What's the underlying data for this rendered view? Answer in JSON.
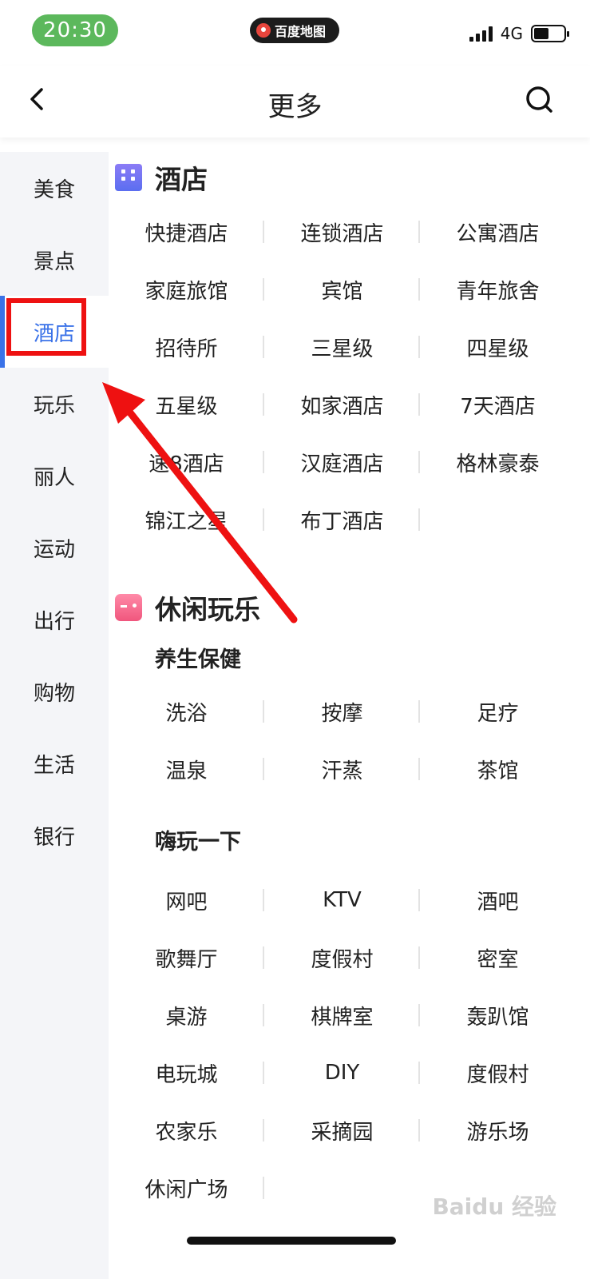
{
  "status_bar": {
    "time": "20:30",
    "app_badge": "百度地图",
    "network": "4G"
  },
  "header": {
    "title": "更多"
  },
  "sidebar": {
    "items": [
      {
        "label": "美食"
      },
      {
        "label": "景点"
      },
      {
        "label": "酒店",
        "active": true
      },
      {
        "label": "玩乐"
      },
      {
        "label": "丽人"
      },
      {
        "label": "运动"
      },
      {
        "label": "出行"
      },
      {
        "label": "购物"
      },
      {
        "label": "生活"
      },
      {
        "label": "银行"
      }
    ]
  },
  "hotel_section": {
    "title": "酒店",
    "items": [
      "快捷酒店",
      "连锁酒店",
      "公寓酒店",
      "家庭旅馆",
      "宾馆",
      "青年旅舍",
      "招待所",
      "三星级",
      "四星级",
      "五星级",
      "如家酒店",
      "7天酒店",
      "速8酒店",
      "汉庭酒店",
      "格林豪泰",
      "锦江之星",
      "布丁酒店"
    ]
  },
  "fun_section": {
    "title": "休闲玩乐",
    "groups": [
      {
        "title": "养生保健",
        "items": [
          "洗浴",
          "按摩",
          "足疗",
          "温泉",
          "汗蒸",
          "茶馆"
        ]
      },
      {
        "title": "嗨玩一下",
        "items": [
          "网吧",
          "KTV",
          "酒吧",
          "歌舞厅",
          "度假村",
          "密室",
          "桌游",
          "棋牌室",
          "轰趴馆",
          "电玩城",
          "DIY",
          "度假村",
          "农家乐",
          "采摘园",
          "游乐场",
          "休闲广场"
        ]
      }
    ]
  },
  "watermark": "Baidu 经验",
  "colors": {
    "accent": "#3a72e8",
    "highlight_red": "#ee1111",
    "time_pill": "#5cb85c"
  }
}
